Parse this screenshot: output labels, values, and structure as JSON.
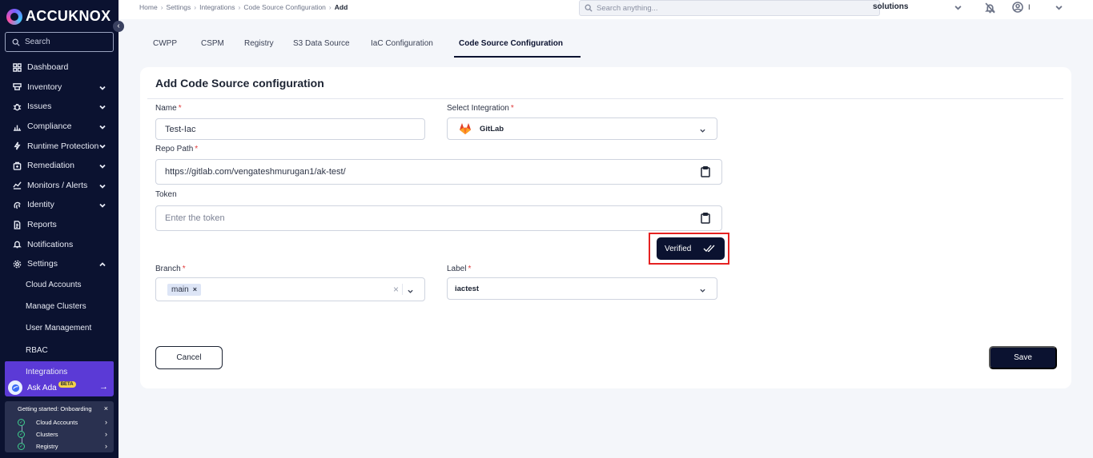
{
  "brand": {
    "name": "ACCUKNOX"
  },
  "sidebar": {
    "search_placeholder": "Search",
    "items": [
      {
        "label": "Dashboard",
        "icon": "dashboard-icon",
        "expandable": false
      },
      {
        "label": "Inventory",
        "icon": "inventory-icon",
        "expandable": true
      },
      {
        "label": "Issues",
        "icon": "bug-icon",
        "expandable": true
      },
      {
        "label": "Compliance",
        "icon": "compliance-icon",
        "expandable": true
      },
      {
        "label": "Runtime Protection",
        "icon": "runtime-icon",
        "expandable": true
      },
      {
        "label": "Remediation",
        "icon": "remediation-icon",
        "expandable": true
      },
      {
        "label": "Monitors / Alerts",
        "icon": "monitor-icon",
        "expandable": true
      },
      {
        "label": "Identity",
        "icon": "fingerprint-icon",
        "expandable": true
      },
      {
        "label": "Reports",
        "icon": "reports-icon",
        "expandable": false
      },
      {
        "label": "Notifications",
        "icon": "bell-icon",
        "expandable": false
      },
      {
        "label": "Settings",
        "icon": "gear-icon",
        "expandable": true,
        "expanded": true
      }
    ],
    "settings_sub": [
      "Cloud Accounts",
      "Manage Clusters",
      "User Management",
      "RBAC",
      "Integrations"
    ],
    "active_sub": "Integrations",
    "ask_ada": {
      "label": "Ask Ada",
      "badge": "BETA"
    },
    "onboarding": {
      "title": "Getting started: Onboarding",
      "steps": [
        "Cloud Accounts",
        "Clusters",
        "Registry"
      ]
    }
  },
  "topbar": {
    "breadcrumb": [
      "Home",
      "Settings",
      "Integrations",
      "Code Source Configuration",
      "Add"
    ],
    "search_placeholder": "Search anything...",
    "tenant": "solutions",
    "user": "I"
  },
  "tabs": [
    "CWPP",
    "CSPM",
    "Registry",
    "S3 Data Source",
    "IaC Configuration",
    "Code Source Configuration"
  ],
  "active_tab": "Code Source Configuration",
  "form": {
    "title": "Add Code Source configuration",
    "name": {
      "label": "Name",
      "value": "Test-Iac",
      "required": true
    },
    "integration": {
      "label": "Select Integration",
      "value": "GitLab",
      "required": true
    },
    "repo_path": {
      "label": "Repo Path",
      "value": "https://gitlab.com/vengateshmurugan1/ak-test/",
      "required": true
    },
    "token": {
      "label": "Token",
      "placeholder": "Enter the token",
      "value": ""
    },
    "verified_label": "Verified",
    "branch": {
      "label": "Branch",
      "chip": "main",
      "required": true
    },
    "label_field": {
      "label": "Label",
      "value": "iactest",
      "required": true
    },
    "cancel_label": "Cancel",
    "save_label": "Save"
  },
  "colors": {
    "sidebar_bg": "#0b1230",
    "accent": "#5b3ad6",
    "primary_button": "#0b1230",
    "required": "#e03a3a",
    "highlight_box": "#e52222"
  }
}
